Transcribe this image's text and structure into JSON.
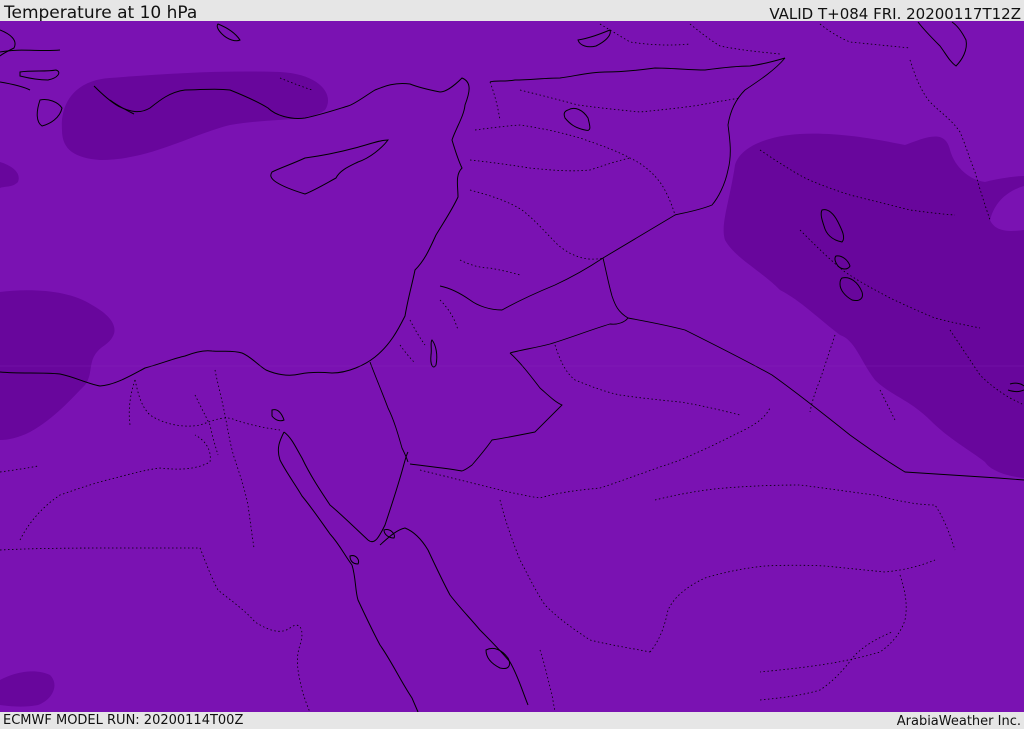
{
  "header": {
    "title": "Temperature at 10 hPa",
    "valid": "VALID T+084 FRI. 20200117T12Z"
  },
  "footer": {
    "model_run": "ECMWF MODEL RUN: 20200114T00Z",
    "credit": "ArabiaWeather Inc."
  },
  "colors": {
    "base_field": "#7a12b2",
    "colder_field": "#68069c",
    "border": "#000000",
    "frame": "#e6e6e6"
  }
}
